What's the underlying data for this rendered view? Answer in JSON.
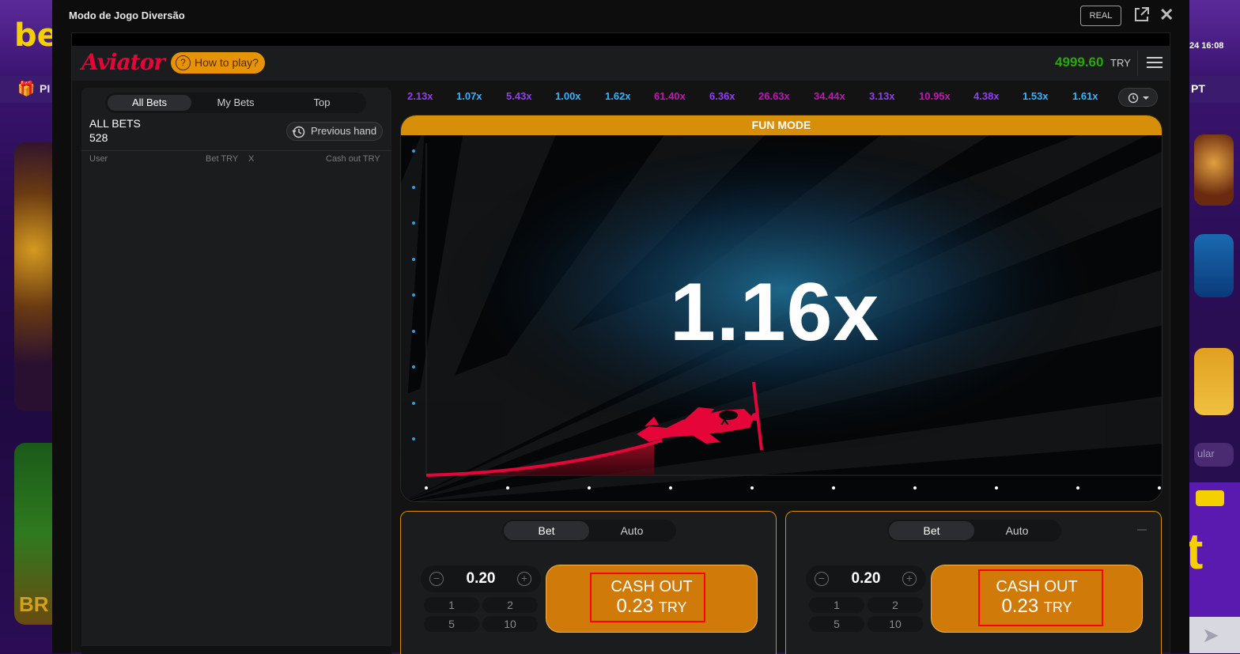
{
  "background": {
    "brand_text": "be",
    "nav_left": "PI",
    "nav_right": "PT",
    "time": "24 16:08",
    "tile_left_text": "BR",
    "tile_right_text": "ular",
    "tile_right_big": "t"
  },
  "modal": {
    "title": "Modo de Jogo Diversão",
    "real_label": "REAL"
  },
  "header": {
    "logo": "Aviator",
    "how_to_play": "How to play?",
    "balance": "4999.60",
    "currency": "TRY"
  },
  "bets_panel": {
    "tabs": [
      "All Bets",
      "My Bets",
      "Top"
    ],
    "active_tab": "All Bets",
    "title": "ALL BETS",
    "count": "528",
    "previous_hand": "Previous hand",
    "columns": {
      "user": "User",
      "bet": "Bet TRY",
      "x": "X",
      "cashout": "Cash out TRY"
    }
  },
  "history": {
    "multipliers": [
      {
        "v": "2.13x",
        "c": "#913ef8"
      },
      {
        "v": "1.07x",
        "c": "#34b4ff"
      },
      {
        "v": "5.43x",
        "c": "#913ef8"
      },
      {
        "v": "1.00x",
        "c": "#34b4ff"
      },
      {
        "v": "1.62x",
        "c": "#34b4ff"
      },
      {
        "v": "61.40x",
        "c": "#c017b4"
      },
      {
        "v": "6.36x",
        "c": "#913ef8"
      },
      {
        "v": "26.63x",
        "c": "#c017b4"
      },
      {
        "v": "34.44x",
        "c": "#c017b4"
      },
      {
        "v": "3.13x",
        "c": "#913ef8"
      },
      {
        "v": "10.95x",
        "c": "#c017b4"
      },
      {
        "v": "4.38x",
        "c": "#913ef8"
      },
      {
        "v": "1.53x",
        "c": "#34b4ff"
      },
      {
        "v": "1.61x",
        "c": "#34b4ff"
      }
    ]
  },
  "play": {
    "fun_mode": "FUN MODE",
    "multiplier": "1.16x",
    "plane_marker": "X"
  },
  "bet_panels": [
    {
      "tabs": [
        "Bet",
        "Auto"
      ],
      "stake": "0.20",
      "quick": [
        "1",
        "2",
        "5",
        "10"
      ],
      "cashout_label": "CASH OUT",
      "cashout_amount": "0.23",
      "cashout_currency": "TRY"
    },
    {
      "tabs": [
        "Bet",
        "Auto"
      ],
      "stake": "0.20",
      "quick": [
        "1",
        "2",
        "5",
        "10"
      ],
      "cashout_label": "CASH OUT",
      "cashout_amount": "0.23",
      "cashout_currency": "TRY"
    }
  ],
  "colors": {
    "accent": "#d78f0a",
    "balance": "#28a909",
    "brand_red": "#e50539"
  }
}
